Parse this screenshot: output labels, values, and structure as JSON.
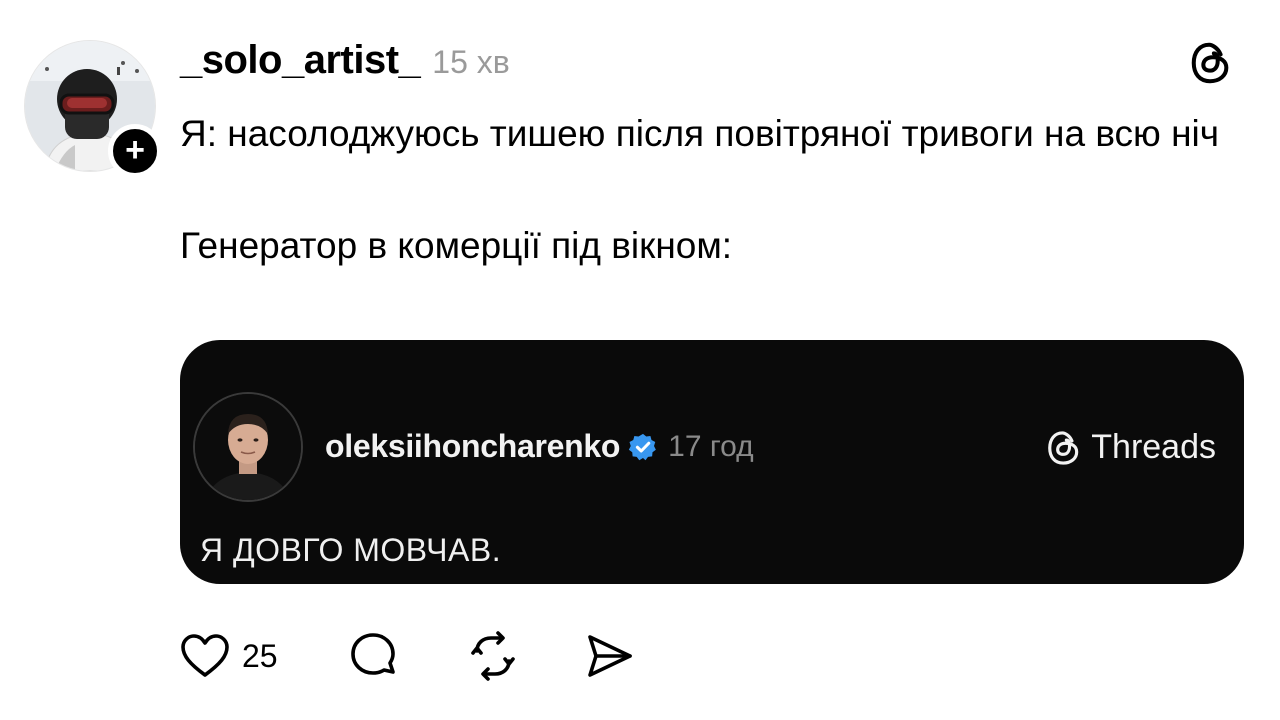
{
  "post": {
    "username": "_solo_artist_",
    "time": "15 хв",
    "follow_symbol": "+",
    "text_line1": "Я: насолоджуюсь тишею після повітряної тривоги на всю ніч",
    "text_line2": "Генератор в комерції під вікном:"
  },
  "embed": {
    "username": "oleksiihoncharenko",
    "time": "17 год",
    "brand": "Threads",
    "text": "Я ДОВГО МОВЧАВ.",
    "verified_color": "#3897f0"
  },
  "actions": {
    "like_count": "25",
    "icons": [
      "heart-icon",
      "comment-icon",
      "repost-icon",
      "share-icon"
    ]
  },
  "colors": {
    "background": "#ffffff",
    "card": "#0a0a0a",
    "muted": "#9a9a9a"
  }
}
